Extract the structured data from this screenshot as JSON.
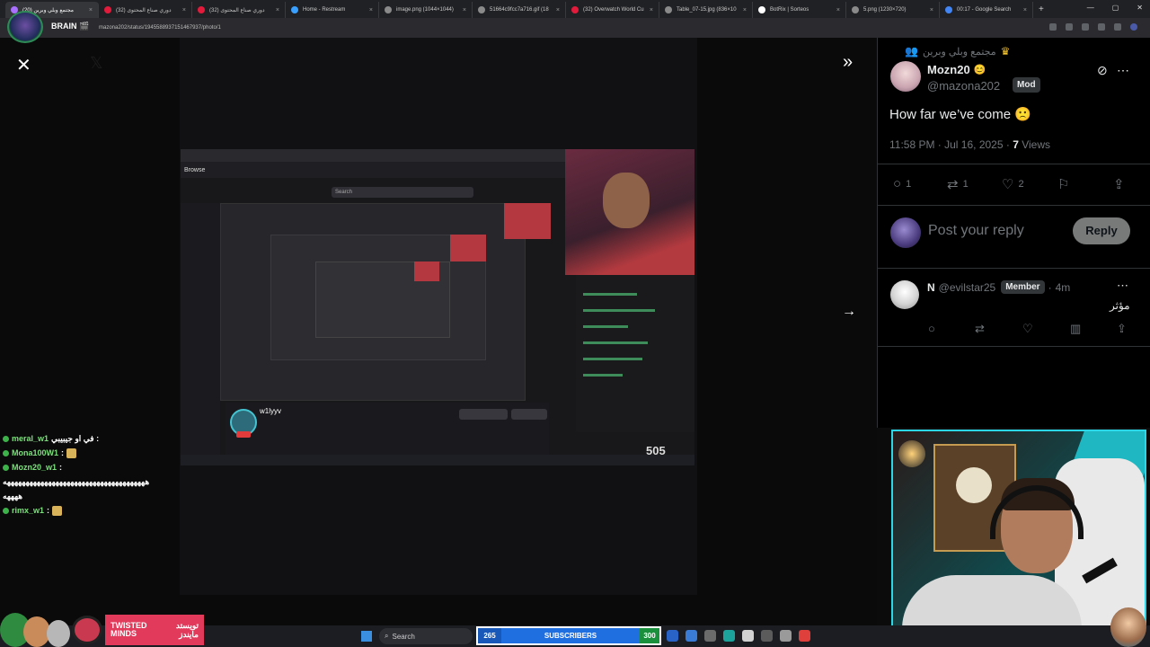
{
  "browser": {
    "tabs": [
      {
        "label": "مجتمع وبلي وبرين (20)",
        "color": "#a970ff",
        "active": true
      },
      {
        "label": "(32) دوري صناع المحتوى",
        "color": "#e21b3c",
        "active": false
      },
      {
        "label": "(32) دوري صناع المحتوى",
        "color": "#e21b3c",
        "active": false
      },
      {
        "label": "Home - Restream",
        "color": "#3aa0ff",
        "active": false
      },
      {
        "label": "image.png (1044×1044)",
        "color": "#8a8a8a",
        "active": false
      },
      {
        "label": "51664c9fcc7a716.gif (18",
        "color": "#8a8a8a",
        "active": false
      },
      {
        "label": "(32) Overwatch World Cu",
        "color": "#e21b3c",
        "active": false
      },
      {
        "label": "Table_07-15.jpg (836×10",
        "color": "#8a8a8a",
        "active": false
      },
      {
        "label": "BotRix | Sorteos",
        "color": "#ffffff",
        "active": false
      },
      {
        "label": "5.png (1230×720)",
        "color": "#8a8a8a",
        "active": false
      },
      {
        "label": "00:17 - Google Search",
        "color": "#4285f4",
        "active": false
      }
    ],
    "url": "mazona202/status/1945588937151467937/photo/1",
    "badge_label": "BRAIN 🎬"
  },
  "viewer": {
    "close_icon": "✕",
    "collapse_icon": "»",
    "next_icon": "→",
    "photo": {
      "nav_tab": "Browse",
      "search_placeholder": "Search",
      "streamer_name": "w1lyyv",
      "sub_count": "505"
    },
    "actions": {
      "replies": "1",
      "reposts": "1",
      "likes": "2",
      "views": "7"
    }
  },
  "stream_chat": [
    {
      "user": "meral_w1",
      "message": "في او جيبيبي :",
      "emote": false
    },
    {
      "user": "Mona100W1",
      "message": ":",
      "emote": true
    },
    {
      "user": "Mozn20_w1",
      "message": ":",
      "emote": false
    },
    {
      "user": "",
      "message": "ههههههههههههههههههههههههههههههههههههههه",
      "emote": false
    },
    {
      "user": "",
      "message": "ههههه",
      "emote": false
    },
    {
      "user": "rimx_w1",
      "message": ":",
      "emote": true
    }
  ],
  "post": {
    "community": "مجتمع وبلي وبرين",
    "author_name": "Mozn20",
    "author_handle": "@mazona202",
    "author_badge": "Mod",
    "text": "How far we’ve come 🙁",
    "time": "11:58 PM · Jul 16, 2025 · ",
    "views_count": "7",
    "views_label": " Views",
    "stats": {
      "replies": "1",
      "reposts": "1",
      "likes": "2"
    },
    "reply_placeholder": "Post your reply",
    "reply_button": "Reply"
  },
  "comment": {
    "name": "N",
    "handle": "@evilstar25",
    "badge": "Member",
    "time": "4m",
    "text": "مؤثر"
  },
  "taskbar": {
    "search_label": "Search",
    "subscribers_current": "265",
    "subscribers_label": "SUBSCRIBERS",
    "subscribers_goal": "300"
  },
  "branding": {
    "name_en": "TWISTED MINDS",
    "name_ar": "تويستد مايندز"
  },
  "colors": {
    "accent": "#1d9bf0",
    "webcam_border": "#2bd7e6",
    "brand": "#e23a5b"
  }
}
